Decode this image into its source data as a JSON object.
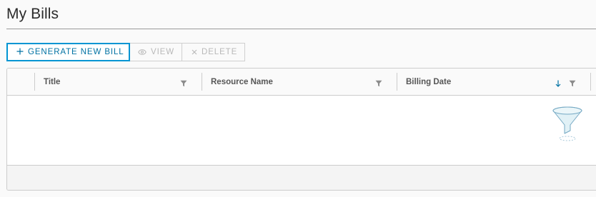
{
  "page": {
    "title": "My Bills"
  },
  "toolbar": {
    "generate_label": "GENERATE NEW BILL",
    "generate_icon": "plus-icon",
    "view_label": "VIEW",
    "view_icon": "eye-icon",
    "delete_label": "DELETE",
    "delete_icon": "close-icon"
  },
  "grid": {
    "columns": [
      {
        "label": "Title",
        "filter_icon": "filter-icon"
      },
      {
        "label": "Resource Name",
        "filter_icon": "filter-icon"
      },
      {
        "label": "Billing Date",
        "filter_icon": "filter-icon",
        "sort_icon": "arrow-down-icon",
        "sort": "descending"
      }
    ],
    "rows": [],
    "empty_icon": "empty-funnel-icon",
    "footer_text": ""
  },
  "colors": {
    "accent": "#0095d3",
    "accent_text": "#0072a3",
    "disabled_text": "#b8b8b8",
    "border": "#cccccc",
    "header_bg": "#fafafa"
  }
}
